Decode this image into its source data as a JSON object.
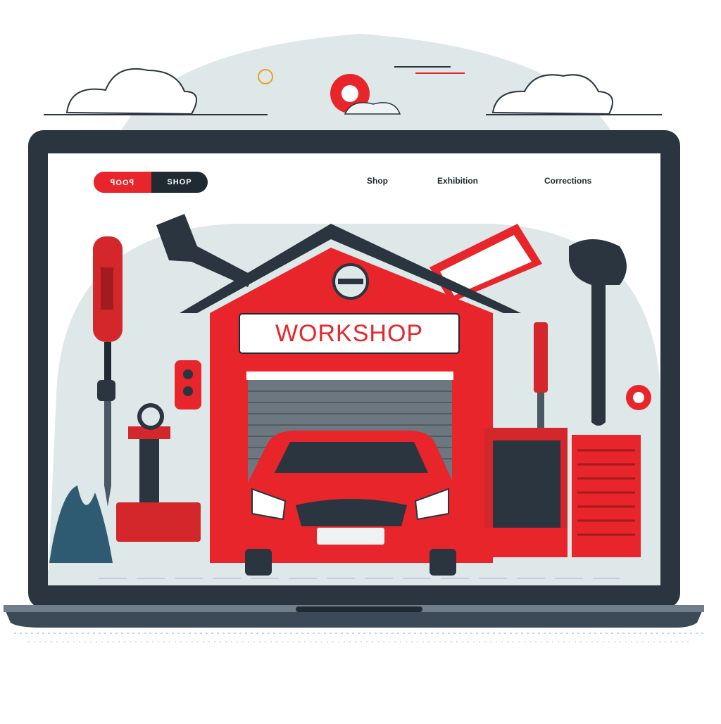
{
  "nav": {
    "primary_label": "ꟼOOꟼ",
    "secondary_label": "SHOP",
    "links": [
      "Shop",
      "Exhibition",
      "Corrections"
    ]
  },
  "sign": {
    "text": "WORKSHOP"
  },
  "colors": {
    "accent": "#e8252a",
    "dark": "#1f2a33",
    "laptop_frame": "#2a3540",
    "backdrop": "#dfe8e9",
    "shutter": "#6d7780"
  }
}
